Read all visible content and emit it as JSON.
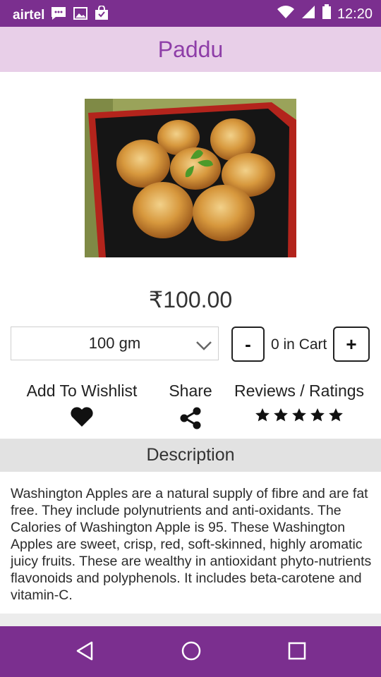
{
  "status_bar": {
    "carrier": "airtel",
    "time": "12:20",
    "icons": [
      "chat-icon",
      "image-icon",
      "shopping-bag-icon",
      "wifi-icon",
      "signal-icon",
      "battery-icon"
    ]
  },
  "app_bar": {
    "title": "Paddu"
  },
  "product": {
    "image_icon": "paddu-food-photo",
    "price": "₹100.00"
  },
  "quantity": {
    "selected_weight": "100 gm",
    "minus_label": "-",
    "plus_label": "+",
    "cart_text": "0 in Cart"
  },
  "actions": {
    "wishlist_label": "Add To Wishlist",
    "share_label": "Share",
    "reviews_label": "Reviews / Ratings",
    "rating_stars": 5
  },
  "description": {
    "header": "Description",
    "text": "Washington Apples are a natural supply of fibre and are fat free. They include polynutrients and anti-oxidants. The Calories of Washington Apple is 95. These Washington Apples are sweet, crisp, red, soft-skinned, highly aromatic juicy fruits. These are wealthy in antioxidant phyto-nutrients flavonoids and polyphenols. It includes beta-carotene and vitamin-C."
  },
  "colors": {
    "primary": "#7b2f8f",
    "app_bar_bg": "#e8cfe8",
    "title_color": "#8e3ea8"
  },
  "nav_bar": {
    "icons": [
      "back-icon",
      "home-icon",
      "recents-icon"
    ]
  }
}
